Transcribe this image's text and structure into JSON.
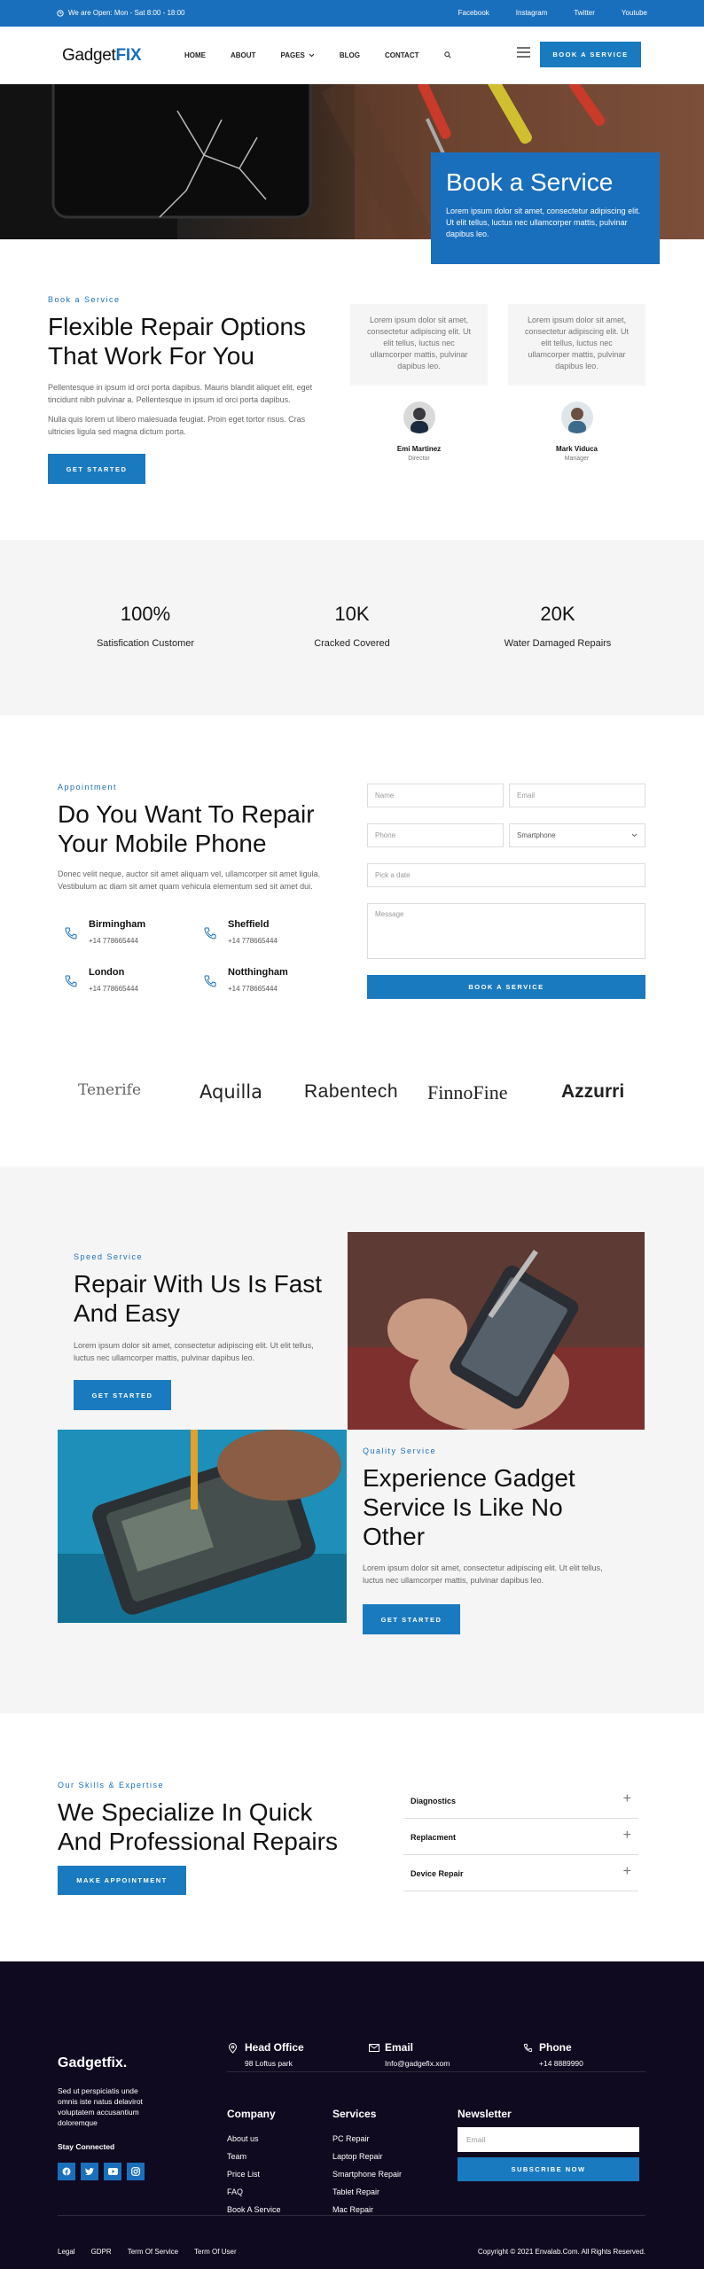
{
  "topbar": {
    "hours": "We are Open: Mon - Sat 8:00 - 18:00",
    "social": [
      "Facebook",
      "Instagram",
      "Twitter",
      "Youtube"
    ]
  },
  "nav": {
    "logo_main": "Gadget",
    "logo_accent": "FIX",
    "items": [
      "HOME",
      "ABOUT",
      "PAGES",
      "BLOG",
      "CONTACT"
    ],
    "cta": "BOOK A SERVICE"
  },
  "hero": {
    "title": "Book a Service",
    "text": "Lorem ipsum dolor sit amet, consectetur adipiscing elit. Ut elit tellus, luctus nec ullamcorper mattis, pulvinar dapibus leo."
  },
  "repair": {
    "eyebrow": "Book a Service",
    "title": "Flexible Repair Options That Work For You",
    "p1": "Pellentesque in ipsum id orci porta dapibus. Mauris blandit aliquet elit, eget tincidunt nibh pulvinar a. Pellentesque in ipsum id orci porta dapibus.",
    "p2": "Nulla quis lorem ut libero malesuada feugiat. Proin eget tortor risus. Cras ultricies ligula sed magna dictum porta.",
    "cta": "GET STARTED",
    "testimonials": [
      {
        "text": "Lorem ipsum dolor sit amet, consectetur adipiscing elit. Ut elit tellus, luctus nec ullamcorper mattis, pulvinar dapibus leo.",
        "name": "Emi Martinez",
        "role": "Director"
      },
      {
        "text": "Lorem ipsum dolor sit amet, consectetur adipiscing elit. Ut elit tellus, luctus nec ullamcorper mattis, pulvinar dapibus leo.",
        "name": "Mark Viduca",
        "role": "Manager"
      }
    ]
  },
  "stats": [
    {
      "value": "100%",
      "label": "Satisfication Customer"
    },
    {
      "value": "10K",
      "label": "Cracked Covered"
    },
    {
      "value": "20K",
      "label": "Water Damaged Repairs"
    }
  ],
  "appointment": {
    "eyebrow": "Appointment",
    "title": "Do You Want To Repair Your Mobile Phone",
    "text": "Donec velit neque, auctor sit amet aliquam vel, ullamcorper sit amet ligula. Vestibulum ac diam sit amet quam vehicula elementum sed sit amet dui.",
    "locations": [
      {
        "city": "Birmingham",
        "phone": "+14 778665444"
      },
      {
        "city": "Sheffield",
        "phone": "+14 778665444"
      },
      {
        "city": "London",
        "phone": "+14 778665444"
      },
      {
        "city": "Notthingham",
        "phone": "+14 778665444"
      }
    ],
    "form": {
      "name": "Name",
      "email": "Email",
      "phone": "Phone",
      "device": "Smartphone",
      "date": "Pick a date",
      "message": "Message",
      "submit": "BOOK A SERVICE"
    }
  },
  "brands": [
    "Tenerife",
    "Aquilla",
    "Rabentech",
    "FinnoFine",
    "Azzurri"
  ],
  "speed": {
    "eyebrow": "Speed Service",
    "title": "Repair With Us Is Fast And Easy",
    "text": "Lorem ipsum dolor sit amet, consectetur adipiscing elit. Ut elit tellus, luctus nec ullamcorper mattis, pulvinar dapibus leo.",
    "cta": "GET STARTED"
  },
  "quality": {
    "eyebrow": "Quality Service",
    "title": "Experience Gadget Service Is Like No Other",
    "text": "Lorem ipsum dolor sit amet, consectetur adipiscing elit. Ut elit tellus, luctus nec ullamcorper mattis, pulvinar dapibus leo.",
    "cta": "GET STARTED"
  },
  "skills": {
    "eyebrow": "Our Skills & Expertise",
    "title": "We Specialize In Quick And Professional Repairs",
    "cta": "MAKE APPOINTMENT",
    "items": [
      "Diagnostics",
      "Replacment",
      "Device Repair"
    ]
  },
  "footer": {
    "brand": "Gadgetfix.",
    "about": "Sed ut perspiciatis unde omnis iste natus delavirot voluptatem accusantium doloremque",
    "stay": "Stay Connected",
    "contacts": [
      {
        "title": "Head Office",
        "value": "98 Loftus park"
      },
      {
        "title": "Email",
        "value": "Info@gadgefix.xom"
      },
      {
        "title": "Phone",
        "value": "+14 8889990"
      }
    ],
    "company_title": "Company",
    "company": [
      "About us",
      "Team",
      "Price List",
      "FAQ",
      "Book A Service"
    ],
    "services_title": "Services",
    "services": [
      "PC Repair",
      "Laptop Repair",
      "Smartphone Repair",
      "Tablet Repair",
      "Mac Repair"
    ],
    "newsletter_title": "Newsletter",
    "email_placeholder": "Email",
    "subscribe": "SUBSCRIBE NOW",
    "legal": [
      "Legal",
      "GDPR",
      "Term Of Service",
      "Term Of User"
    ],
    "copyright": "Copyright © 2021 Envalab.Com. All Rights Reserved."
  }
}
